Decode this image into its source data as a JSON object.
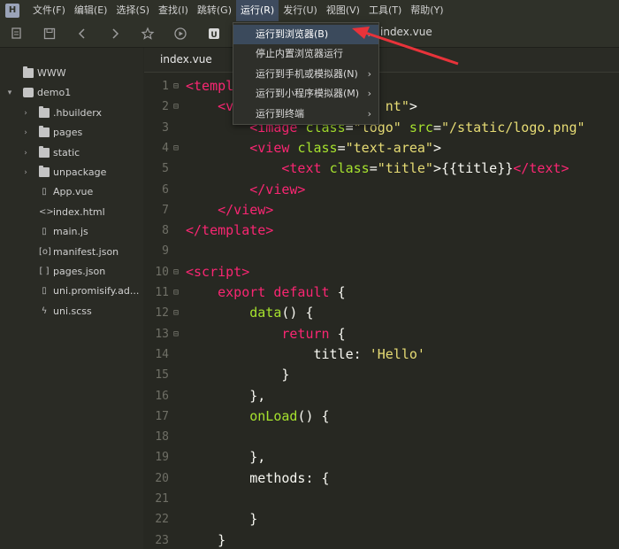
{
  "menubar": {
    "logo": "H",
    "items": [
      "文件(F)",
      "编辑(E)",
      "选择(S)",
      "查找(I)",
      "跳转(G)",
      "运行(R)",
      "发行(U)",
      "视图(V)",
      "工具(T)",
      "帮助(Y)"
    ]
  },
  "toolbar": {
    "open_tab": "index.vue",
    "icons": [
      "new-file-icon",
      "save-icon",
      "back-icon",
      "forward-icon",
      "star-icon",
      "run-icon",
      "uniapp-icon"
    ]
  },
  "run_menu": {
    "items": [
      {
        "label": "运行到浏览器(B)",
        "submenu": true
      },
      {
        "label": "停止内置浏览器运行",
        "submenu": false
      },
      {
        "label": "运行到手机或模拟器(N)",
        "submenu": true
      },
      {
        "label": "运行到小程序模拟器(M)",
        "submenu": true
      },
      {
        "label": "运行到终端",
        "submenu": true
      }
    ],
    "submenu_glyph": "›"
  },
  "sidebar": {
    "items": [
      {
        "label": "WWW",
        "type": "web-root",
        "depth": 0,
        "arrow": ""
      },
      {
        "label": "demo1",
        "type": "project",
        "depth": 0,
        "arrow": "▾"
      },
      {
        "label": ".hbuilderx",
        "type": "folder",
        "depth": 1,
        "arrow": "›"
      },
      {
        "label": "pages",
        "type": "folder",
        "depth": 1,
        "arrow": "›"
      },
      {
        "label": "static",
        "type": "folder",
        "depth": 1,
        "arrow": "›"
      },
      {
        "label": "unpackage",
        "type": "folder",
        "depth": 1,
        "arrow": "›"
      },
      {
        "label": "App.vue",
        "type": "file",
        "glyph": "▯",
        "depth": 1,
        "arrow": ""
      },
      {
        "label": "index.html",
        "type": "file",
        "glyph": "<>",
        "depth": 1,
        "arrow": ""
      },
      {
        "label": "main.js",
        "type": "file",
        "glyph": "▯",
        "depth": 1,
        "arrow": ""
      },
      {
        "label": "manifest.json",
        "type": "file",
        "glyph": "[o]",
        "depth": 1,
        "arrow": ""
      },
      {
        "label": "pages.json",
        "type": "file",
        "glyph": "[ ]",
        "depth": 1,
        "arrow": ""
      },
      {
        "label": "uni.promisify.ad...",
        "type": "file",
        "glyph": "▯",
        "depth": 1,
        "arrow": ""
      },
      {
        "label": "uni.scss",
        "type": "file",
        "glyph": "ϟ",
        "depth": 1,
        "arrow": ""
      }
    ]
  },
  "editor": {
    "tab_label": "index.vue",
    "lines": [
      {
        "n": "1",
        "fold": "⊟",
        "tokens": [
          [
            "tag",
            "<templ"
          ]
        ]
      },
      {
        "n": "2",
        "fold": "⊟",
        "tokens": [
          [
            "plain",
            "    "
          ],
          [
            "tag",
            "<v"
          ],
          [
            "plain",
            "                   "
          ],
          [
            "str",
            "nt\""
          ],
          [
            "plain",
            ">"
          ]
        ]
      },
      {
        "n": "3",
        "fold": "",
        "tokens": [
          [
            "plain",
            "        "
          ],
          [
            "tag",
            "<image "
          ],
          [
            "attr",
            "class"
          ],
          [
            "plain",
            "="
          ],
          [
            "str",
            "\"logo\""
          ],
          [
            "plain",
            " "
          ],
          [
            "attr",
            "src"
          ],
          [
            "plain",
            "="
          ],
          [
            "str",
            "\"/static/logo.png\""
          ]
        ]
      },
      {
        "n": "4",
        "fold": "⊟",
        "tokens": [
          [
            "plain",
            "        "
          ],
          [
            "tag",
            "<view "
          ],
          [
            "attr",
            "class"
          ],
          [
            "plain",
            "="
          ],
          [
            "str",
            "\"text-area\""
          ],
          [
            "plain",
            ">"
          ]
        ]
      },
      {
        "n": "5",
        "fold": "",
        "tokens": [
          [
            "plain",
            "            "
          ],
          [
            "tag",
            "<text "
          ],
          [
            "attr",
            "class"
          ],
          [
            "plain",
            "="
          ],
          [
            "str",
            "\"title\""
          ],
          [
            "plain",
            ">{{title}}"
          ],
          [
            "tag",
            "</text>"
          ]
        ]
      },
      {
        "n": "6",
        "fold": "",
        "tokens": [
          [
            "plain",
            "        "
          ],
          [
            "tag",
            "</view>"
          ]
        ]
      },
      {
        "n": "7",
        "fold": "",
        "tokens": [
          [
            "plain",
            "    "
          ],
          [
            "tag",
            "</view>"
          ]
        ]
      },
      {
        "n": "8",
        "fold": "",
        "tokens": [
          [
            "tag",
            "</template>"
          ]
        ]
      },
      {
        "n": "9",
        "fold": "",
        "tokens": []
      },
      {
        "n": "10",
        "fold": "⊟",
        "tokens": [
          [
            "tag",
            "<script>"
          ]
        ]
      },
      {
        "n": "11",
        "fold": "⊟",
        "tokens": [
          [
            "plain",
            "    "
          ],
          [
            "kw",
            "export default"
          ],
          [
            "plain",
            " {"
          ]
        ]
      },
      {
        "n": "12",
        "fold": "⊟",
        "tokens": [
          [
            "plain",
            "        "
          ],
          [
            "fn",
            "data"
          ],
          [
            "plain",
            "() {"
          ]
        ]
      },
      {
        "n": "13",
        "fold": "⊟",
        "tokens": [
          [
            "plain",
            "            "
          ],
          [
            "kw",
            "return"
          ],
          [
            "plain",
            " {"
          ]
        ]
      },
      {
        "n": "14",
        "fold": "",
        "tokens": [
          [
            "plain",
            "                title: "
          ],
          [
            "str",
            "'Hello'"
          ]
        ]
      },
      {
        "n": "15",
        "fold": "",
        "tokens": [
          [
            "plain",
            "            }"
          ]
        ]
      },
      {
        "n": "16",
        "fold": "",
        "tokens": [
          [
            "plain",
            "        },"
          ]
        ]
      },
      {
        "n": "17",
        "fold": "",
        "tokens": [
          [
            "plain",
            "        "
          ],
          [
            "fn",
            "onLoad"
          ],
          [
            "plain",
            "() {"
          ]
        ]
      },
      {
        "n": "18",
        "fold": "",
        "tokens": []
      },
      {
        "n": "19",
        "fold": "",
        "tokens": [
          [
            "plain",
            "        },"
          ]
        ]
      },
      {
        "n": "20",
        "fold": "",
        "tokens": [
          [
            "plain",
            "        methods: {"
          ]
        ]
      },
      {
        "n": "21",
        "fold": "",
        "tokens": []
      },
      {
        "n": "22",
        "fold": "",
        "tokens": [
          [
            "plain",
            "        }"
          ]
        ]
      },
      {
        "n": "23",
        "fold": "",
        "tokens": [
          [
            "plain",
            "    }"
          ]
        ]
      }
    ]
  },
  "colors": {
    "accent_arrow": "#e8333a",
    "menu_highlight": "#3b4a5c"
  }
}
